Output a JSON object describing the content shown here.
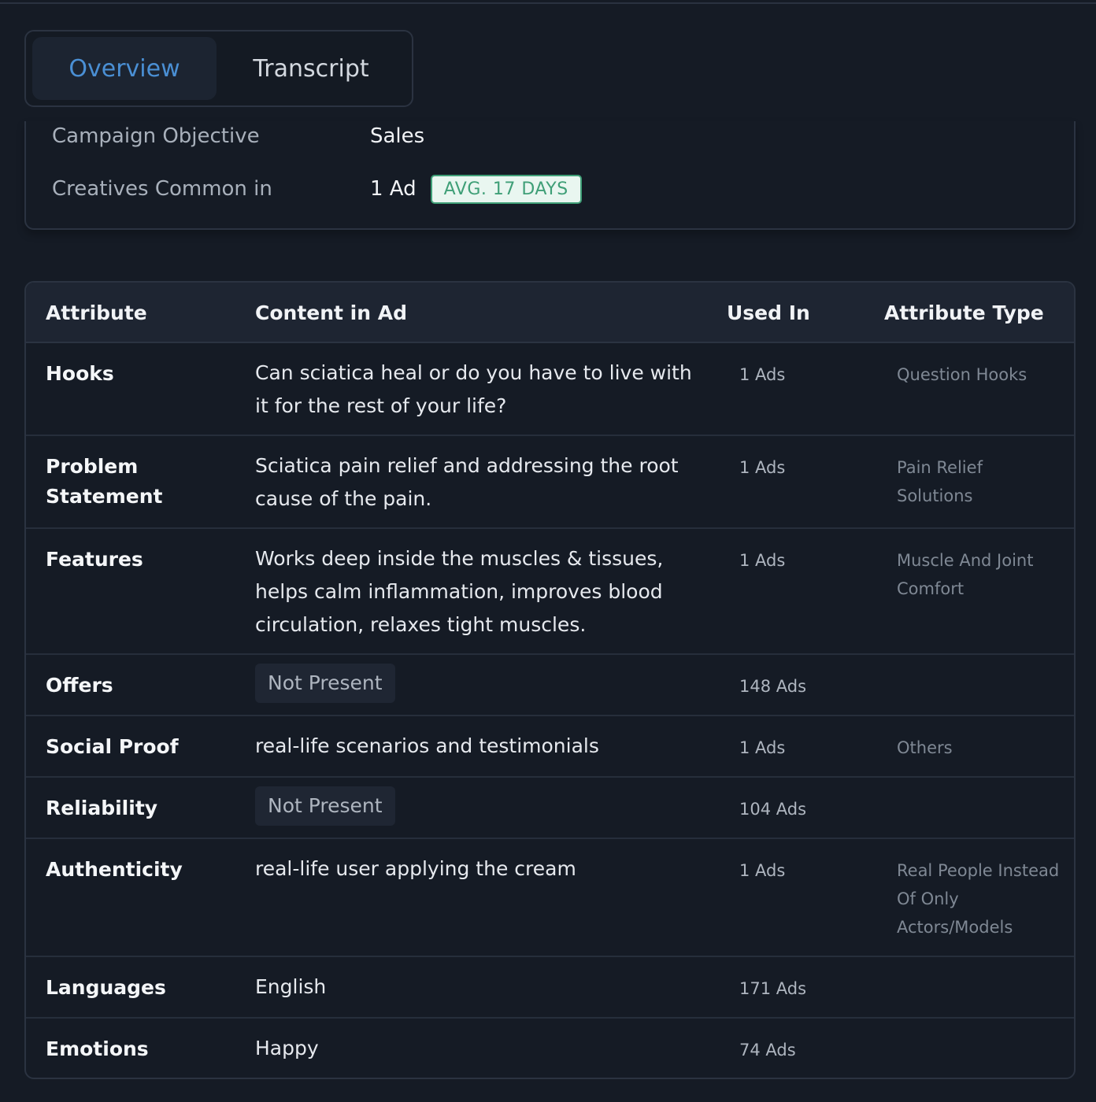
{
  "tabs": [
    {
      "label": "Overview",
      "active": true
    },
    {
      "label": "Transcript",
      "active": false
    }
  ],
  "summary": {
    "objective_label": "Campaign Objective",
    "objective_value": "Sales",
    "common_label": "Creatives Common in",
    "common_value": "1 Ad",
    "common_badge": "AVG. 17 DAYS"
  },
  "table": {
    "headers": {
      "attribute": "Attribute",
      "content": "Content in Ad",
      "used_in": "Used In",
      "type": "Attribute Type"
    },
    "rows": [
      {
        "attribute": "Hooks",
        "content": "Can sciatica heal or do you have to live with it for the rest of your life?",
        "used_in": "1 Ads",
        "type": "Question Hooks"
      },
      {
        "attribute": "Problem Statement",
        "content": "Sciatica pain relief and addressing the root cause of the pain.",
        "used_in": "1 Ads",
        "type": "Pain Relief Solutions"
      },
      {
        "attribute": "Features",
        "content": "Works deep inside the muscles & tissues, helps calm inflammation, improves blood circulation, relaxes tight muscles.",
        "used_in": "1 Ads",
        "type": "Muscle And Joint Comfort"
      },
      {
        "attribute": "Offers",
        "content": "Not Present",
        "used_in": "148 Ads",
        "type": ""
      },
      {
        "attribute": "Social Proof",
        "content": "real-life scenarios and testimonials",
        "used_in": "1 Ads",
        "type": "Others"
      },
      {
        "attribute": "Reliability",
        "content": "Not Present",
        "used_in": "104 Ads",
        "type": ""
      },
      {
        "attribute": "Authenticity",
        "content": "real-life user applying the cream",
        "used_in": "1 Ads",
        "type": "Real People Instead Of Only Actors/Models"
      },
      {
        "attribute": "Languages",
        "content": "English",
        "used_in": "171 Ads",
        "type": ""
      },
      {
        "attribute": "Emotions",
        "content": "Happy",
        "used_in": "74 Ads",
        "type": ""
      }
    ]
  }
}
